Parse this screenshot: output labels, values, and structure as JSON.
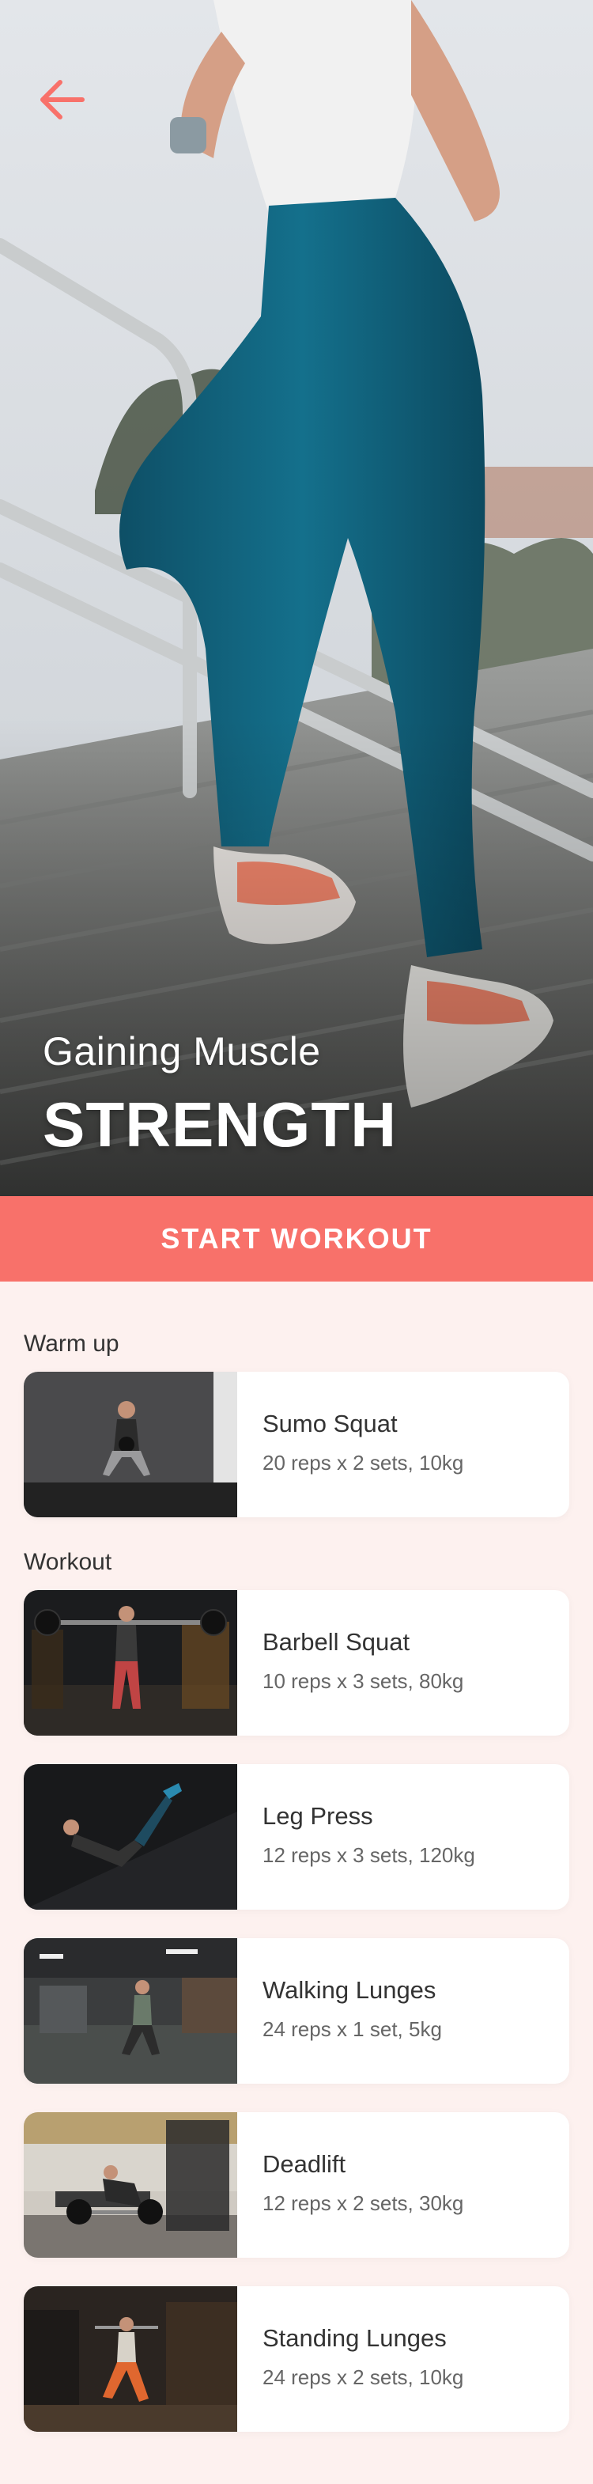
{
  "hero": {
    "subtitle": "Gaining Muscle",
    "title": "STRENGTH"
  },
  "icons": {
    "back": "arrow-left-icon"
  },
  "colors": {
    "accent": "#f8716a",
    "background": "#fdf1ef",
    "card": "#ffffff"
  },
  "start_button": {
    "label": "START WORKOUT"
  },
  "warmup": {
    "title": "Warm up",
    "items": [
      {
        "name": "Sumo Squat",
        "detail": "20 reps x 2 sets, 10kg"
      }
    ]
  },
  "workout": {
    "title": "Workout",
    "items": [
      {
        "name": "Barbell Squat",
        "detail": "10 reps x 3 sets, 80kg"
      },
      {
        "name": "Leg Press",
        "detail": "12 reps x 3 sets, 120kg"
      },
      {
        "name": "Walking Lunges",
        "detail": "24 reps x 1 set, 5kg"
      },
      {
        "name": "Deadlift",
        "detail": "12 reps x 2 sets, 30kg"
      },
      {
        "name": "Standing Lunges",
        "detail": "24 reps x 2 sets, 10kg"
      }
    ]
  }
}
